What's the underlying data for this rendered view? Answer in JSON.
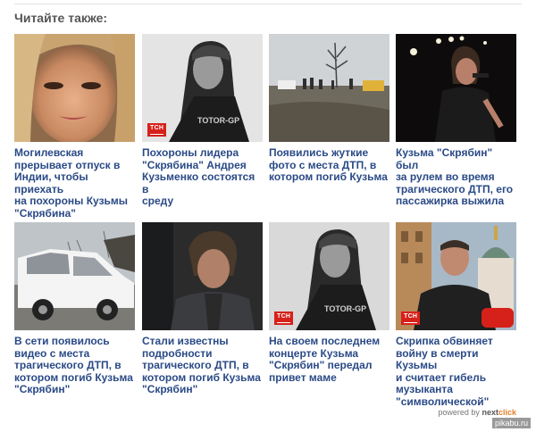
{
  "heading": "Читайте также:",
  "badge_text": "ТСН",
  "articles": [
    {
      "caption": "Могилевская\nпрерывает отпуск в\nИндии, чтобы приехать\nна похороны Кузьмы\n\"Скрябина\"",
      "image": "woman-portrait",
      "has_badge": false
    },
    {
      "caption": "Похороны лидера\n\"Скрябина\" Андрея\nКузьменко состоятся в\nсреду",
      "image": "musician-bandana-bw",
      "has_badge": true
    },
    {
      "caption": "Появились жуткие\nфото с места ДТП, в\nкотором погиб Кузьма",
      "image": "crash-scene-road",
      "has_badge": false
    },
    {
      "caption": "Кузьма \"Скрябин\" был\nза рулем во время\nтрагического ДТП, его\nпассажирка выжила",
      "image": "singer-on-stage",
      "has_badge": false
    },
    {
      "caption": "В сети появилось\nвидео с места\nтрагического ДТП, в\nкотором погиб Кузьма\n\"Скрябин\"",
      "image": "wrecked-white-suv",
      "has_badge": false
    },
    {
      "caption": "Стали известны\nподробности\nтрагического ДТП, в\nкотором погиб Кузьма\n\"Скрябин\"",
      "image": "musician-dark-portrait",
      "has_badge": false
    },
    {
      "caption": "На своем последнем\nконцерте Кузьма\n\"Скрябин\" передал\nпривет маме",
      "image": "musician-bandana-bw",
      "has_badge": true
    },
    {
      "caption": "Скрипка обвиняет\nвойну в смерти Кузьмы\nи считает гибель\nмузыканта\n\"символической\"",
      "image": "man-interview-church",
      "has_badge": true
    }
  ],
  "powered_by": {
    "prefix": "powered by",
    "brand_part1": "next",
    "brand_part2": "click"
  },
  "watermark": "pikabu.ru"
}
